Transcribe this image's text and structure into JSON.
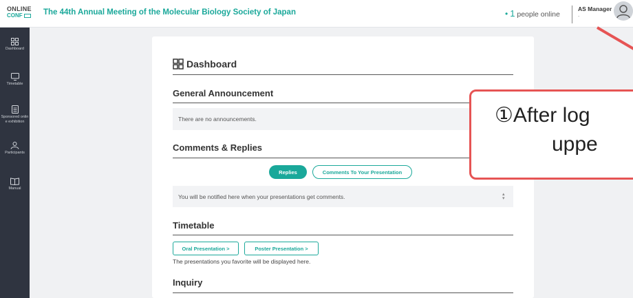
{
  "header": {
    "logo_line1": "ONLINE",
    "logo_line2": "CONF ",
    "title": "The 44th Annual Meeting of the Molecular Biology Society of Japan",
    "online_count": "1",
    "online_label": "people online",
    "user_name": "AS Manager",
    "user_sub": "-"
  },
  "sidebar": {
    "items": [
      {
        "label": "Dashboard",
        "icon": "dashboard-icon"
      },
      {
        "label": "Timetable",
        "icon": "monitor-icon"
      },
      {
        "label": "Sponsored onlin e exhibition",
        "icon": "document-icon"
      },
      {
        "label": "Participants",
        "icon": "people-icon"
      },
      {
        "label": "Manual",
        "icon": "book-icon"
      }
    ]
  },
  "main": {
    "title": "Dashboard",
    "announcement": {
      "title": "General Announcement",
      "empty_text": "There are no announcements."
    },
    "comments": {
      "title": "Comments & Replies",
      "tab_replies": "Replies",
      "tab_comments": "Comments To Your Presentation",
      "notice": "You will be notified here when your presentations get comments."
    },
    "timetable": {
      "title": "Timetable",
      "oral_button": "Oral Presentation >",
      "poster_button": "Poster Presentation >",
      "favorite_note": "The presentations you favorite will be displayed here."
    },
    "inquiry": {
      "title": "Inquiry"
    }
  },
  "callout": {
    "line1": "①After log",
    "line2": "uppe",
    "border_color": "#e65454"
  },
  "colors": {
    "accent": "#1aa89a",
    "sidebar": "#2f3440",
    "callout_border": "#e65454"
  }
}
